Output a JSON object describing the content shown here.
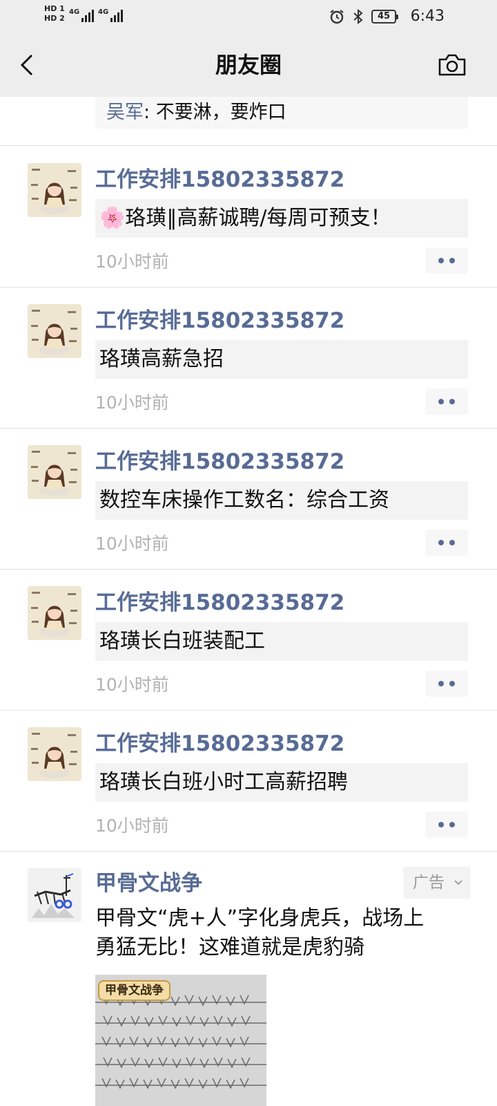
{
  "status_bar": {
    "sim1": "HD 1",
    "sim2": "HD 2",
    "net1": "4G",
    "net2": "4G",
    "battery": "45",
    "time": "6:43"
  },
  "nav": {
    "title": "朋友圈",
    "back_icon": "chevron-left-icon",
    "camera_icon": "camera-icon"
  },
  "top_comment": {
    "author": "吴军",
    "separator": ": ",
    "text": "不要淋，要炸口"
  },
  "posts": [
    {
      "name": "工作安排15802335872",
      "body": "🌸珞璜‖高薪诚聘/每周可预支！",
      "time": "10小时前"
    },
    {
      "name": "工作安排15802335872",
      "body": "珞璜高薪急招",
      "time": "10小时前"
    },
    {
      "name": "工作安排15802335872",
      "body": "数控车床操作工数名：综合工资",
      "time": "10小时前"
    },
    {
      "name": "工作安排15802335872",
      "body": "珞璜长白班装配工",
      "time": "10小时前"
    },
    {
      "name": "工作安排15802335872",
      "body": "珞璜长白班小时工高薪招聘",
      "time": "10小时前"
    }
  ],
  "ad": {
    "name": "甲骨文战争",
    "badge": "广告",
    "text_line1": "甲骨文“虎+人”字化身虎兵，战场上",
    "text_line2": "勇猛无比！这难道就是虎豹骑",
    "image_tag": "甲骨文战争"
  },
  "colors": {
    "bar_bg": "#ededed",
    "name_link": "#576b95",
    "time_gray": "#b2b2b2",
    "body_bg": "#f3f3f3"
  }
}
